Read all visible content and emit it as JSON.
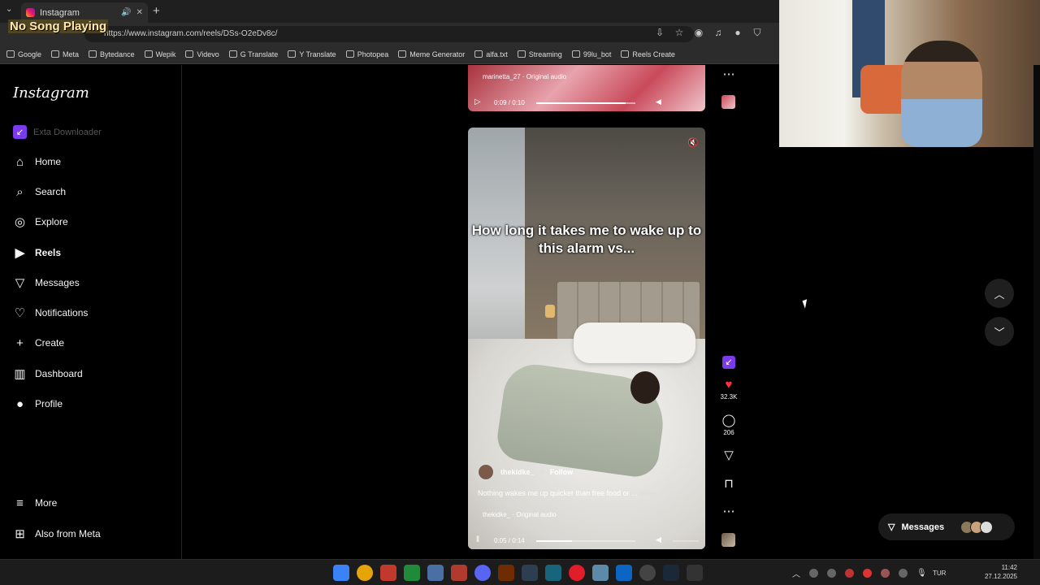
{
  "browser": {
    "tab_title": "Instagram",
    "url": "https://www.instagram.com/reels/DSs-O2eDv8c/",
    "overlay_text": "No Song Playing",
    "bookmarks": [
      "Google",
      "Meta",
      "Bytedance",
      "Wepik",
      "Videvo",
      "G Translate",
      "Y Translate",
      "Photopea",
      "Meme Generator",
      "alfa.txt",
      "Streaming",
      "99lu_bot",
      "Reels Create"
    ]
  },
  "sidebar": {
    "logo": "Instagram",
    "extension": "Exta Downloader",
    "items": [
      {
        "label": "Home",
        "icon": "home-icon"
      },
      {
        "label": "Search",
        "icon": "search-icon"
      },
      {
        "label": "Explore",
        "icon": "compass-icon"
      },
      {
        "label": "Reels",
        "icon": "reels-icon"
      },
      {
        "label": "Messages",
        "icon": "send-icon"
      },
      {
        "label": "Notifications",
        "icon": "heart-icon"
      },
      {
        "label": "Create",
        "icon": "plus-icon"
      },
      {
        "label": "Dashboard",
        "icon": "chart-icon"
      },
      {
        "label": "Profile",
        "icon": "avatar-icon"
      }
    ],
    "more": "More",
    "also": "Also from Meta"
  },
  "prev_reel": {
    "audio": "marinetta_27 · Original audio",
    "time": "0:09 / 0:10",
    "progress": 0.9
  },
  "reel": {
    "caption": "How long it takes me to wake up to this alarm vs...",
    "username": "thekidke_",
    "follow": "Follow",
    "description": "Nothing wakes me up quicker than free food or ...",
    "more": "more",
    "audio": "thekidke_ · Original audio",
    "time": "0:05 / 0:14",
    "progress": 0.36
  },
  "actions": {
    "likes": "32.3K",
    "comments": "206"
  },
  "messages_pill": "Messages",
  "taskbar": {
    "lang": "TUR",
    "time": "11:42",
    "date": "27.12.2025"
  },
  "colors": {
    "accent_purple": "#7c3aed",
    "like_red": "#ff3040"
  }
}
